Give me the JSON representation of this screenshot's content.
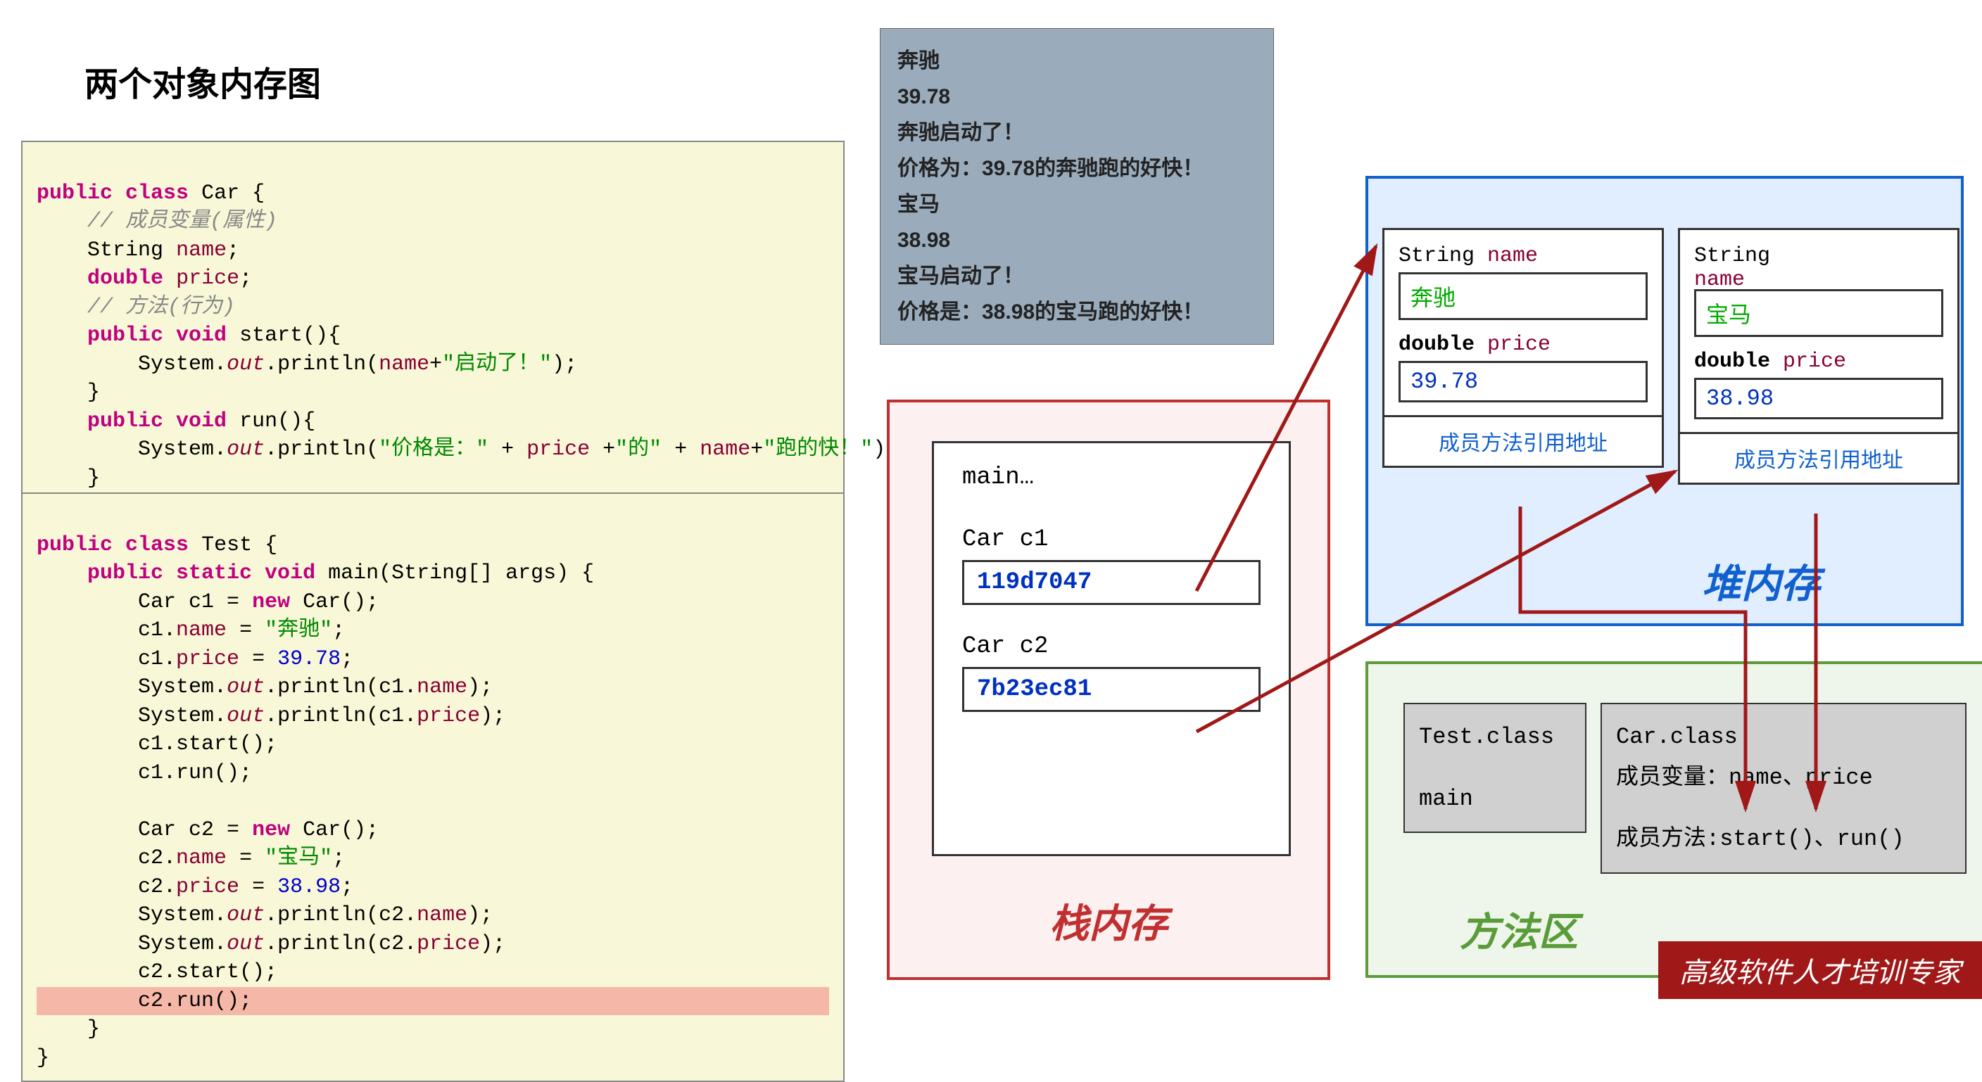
{
  "title": "两个对象内存图",
  "code_car": {
    "l1a": "public",
    "l1b": "class",
    "l1c": "Car {",
    "l2": "// 成员变量(属性)",
    "l3a": "String",
    "l3b": "name",
    "l3c": ";",
    "l4a": "double",
    "l4b": "price",
    "l4c": ";",
    "l5": "// 方法(行为)",
    "l6a": "public void",
    "l6b": "start",
    "l6c": "(){",
    "l7a": "System.",
    "l7b": "out",
    "l7c": ".println(",
    "l7d": "name",
    "l7e": "+",
    "l7f": "\"启动了！\"",
    "l7g": ");",
    "l8": "}",
    "l9a": "public void",
    "l9b": "run",
    "l9c": "(){",
    "l10a": "System.",
    "l10b": "out",
    "l10c": ".println(",
    "l10d": "\"价格是：\"",
    "l10e": " + ",
    "l10f": "price",
    "l10g": " +",
    "l10h": "\"的\"",
    "l10i": " + ",
    "l10j": "name",
    "l10k": "+",
    "l10l": "\"跑的快！\"",
    "l10m": ");",
    "l11": "}",
    "l12": "}"
  },
  "code_test": {
    "l1a": "public",
    "l1b": "class",
    "l1c": "Test {",
    "l2a": "public static void",
    "l2b": "main",
    "l2c": "(String[] args) {",
    "l3a": "Car c1 = ",
    "l3b": "new",
    "l3c": " Car();",
    "l4a": "c1.",
    "l4b": "name",
    "l4c": " = ",
    "l4d": "\"奔驰\"",
    "l4e": ";",
    "l5a": "c1.",
    "l5b": "price",
    "l5c": " = ",
    "l5d": "39.78",
    "l5e": ";",
    "l6a": "System.",
    "l6b": "out",
    "l6c": ".println(c1.",
    "l6d": "name",
    "l6e": ");",
    "l7a": "System.",
    "l7b": "out",
    "l7c": ".println(c1.",
    "l7d": "price",
    "l7e": ");",
    "l8": "c1.start();",
    "l9": "c1.run();",
    "l10a": "Car c2 = ",
    "l10b": "new",
    "l10c": " Car();",
    "l11a": "c2.",
    "l11b": "name",
    "l11c": " = ",
    "l11d": "\"宝马\"",
    "l11e": ";",
    "l12a": "c2.",
    "l12b": "price",
    "l12c": " = ",
    "l12d": "38.98",
    "l12e": ";",
    "l13a": "System.",
    "l13b": "out",
    "l13c": ".println(c2.",
    "l13d": "name",
    "l13e": ");",
    "l14a": "System.",
    "l14b": "out",
    "l14c": ".println(c2.",
    "l14d": "price",
    "l14e": ");",
    "l15": "c2.start();",
    "l16": "c2.run();",
    "l17": "}",
    "l18": "}"
  },
  "console": {
    "l1": "奔驰",
    "l2": "39.78",
    "l3": "奔驰启动了！",
    "l4": "价格为：39.78的奔驰跑的好快！",
    "l5": "宝马",
    "l6": "38.98",
    "l7": "宝马启动了！",
    "l8": "价格是：38.98的宝马跑的好快！"
  },
  "stack": {
    "main": "main…",
    "c1_decl": "Car  c1",
    "c1_addr": "119d7047",
    "c2_decl": "Car  c2",
    "c2_addr": "7b23ec81",
    "label": "栈内存"
  },
  "heap": {
    "obj1": {
      "f1t": "String ",
      "f1n": "name",
      "f1v": "奔驰",
      "f2t": "double ",
      "f2n": "price",
      "f2v": "39.78",
      "mref": "成员方法引用地址"
    },
    "obj2": {
      "f1t": "String",
      "f1n": "name",
      "f1v": "宝马",
      "f2t": "double ",
      "f2n": "price",
      "f2v": "38.98",
      "mref": "成员方法引用地址"
    },
    "label": "堆内存"
  },
  "method_area": {
    "test_cls": "Test.class",
    "test_main": "main",
    "car_cls": "Car.class",
    "car_fields": "成员变量：name、price",
    "car_methods": "成员方法:start()、run()",
    "label": "方法区"
  },
  "footer": "高级软件人才培训专家",
  "colors": {
    "stack_border": "#c03030",
    "heap_border": "#1060d0",
    "method_border": "#5a9c3a",
    "arrow": "#a01818"
  }
}
